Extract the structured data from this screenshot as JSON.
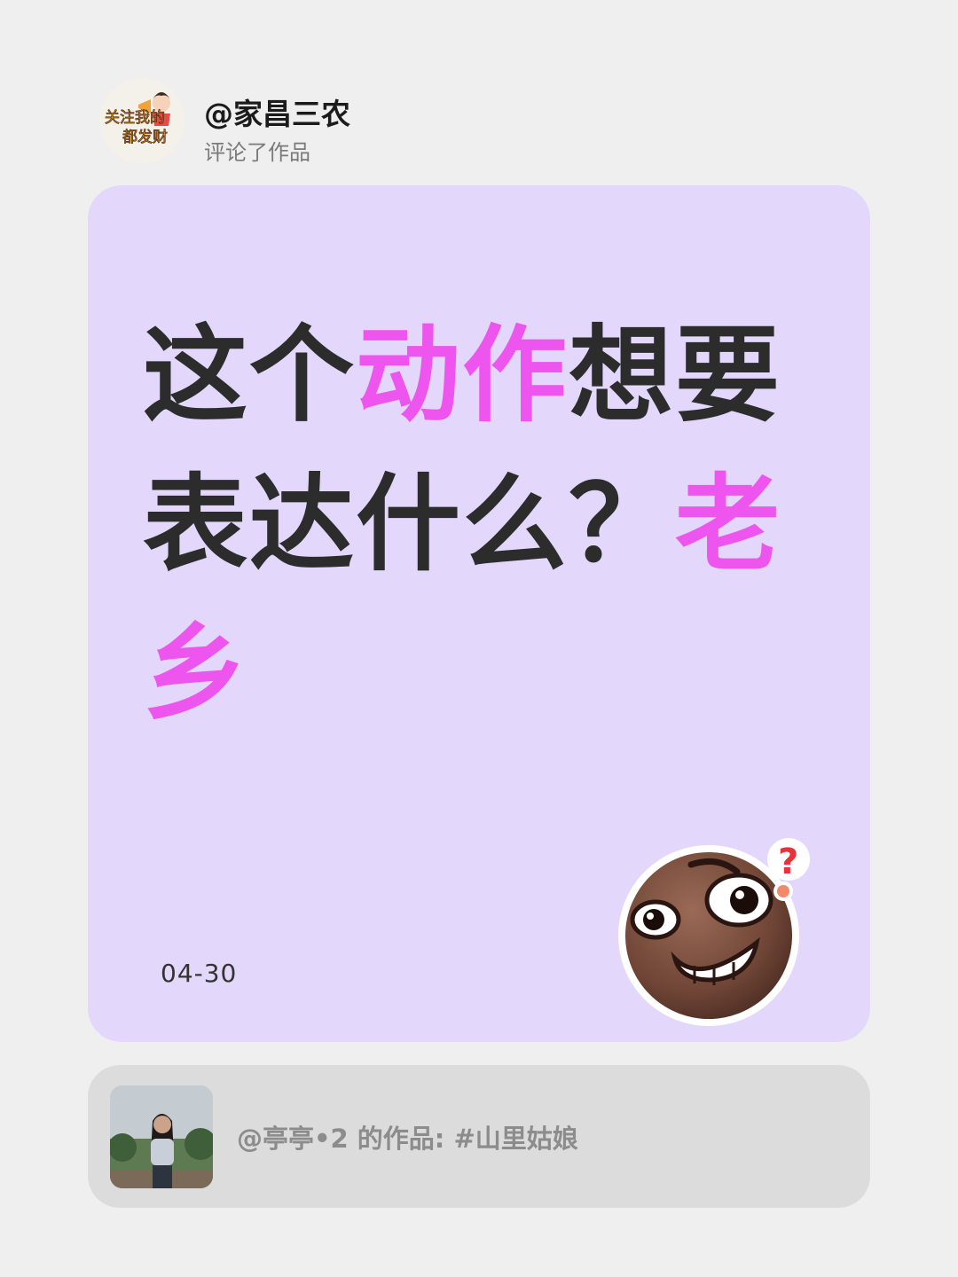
{
  "author": {
    "username": "@家昌三农",
    "action": "评论了作品"
  },
  "comment": {
    "parts": [
      {
        "text": "这个",
        "highlight": false
      },
      {
        "text": "动作",
        "highlight": true
      },
      {
        "text": "想要表达什么？",
        "highlight": false
      },
      {
        "text": "老乡",
        "highlight": true
      }
    ],
    "date": "04-30"
  },
  "sticker": {
    "icon": "grinning-confused-emoji-icon"
  },
  "work": {
    "text": "@亭亭•2 的作品: #山里姑娘"
  },
  "colors": {
    "background": "#efefef",
    "card": "#e3d8fb",
    "highlight": "#ee55ee",
    "work_bar": "#dcdcdc"
  }
}
